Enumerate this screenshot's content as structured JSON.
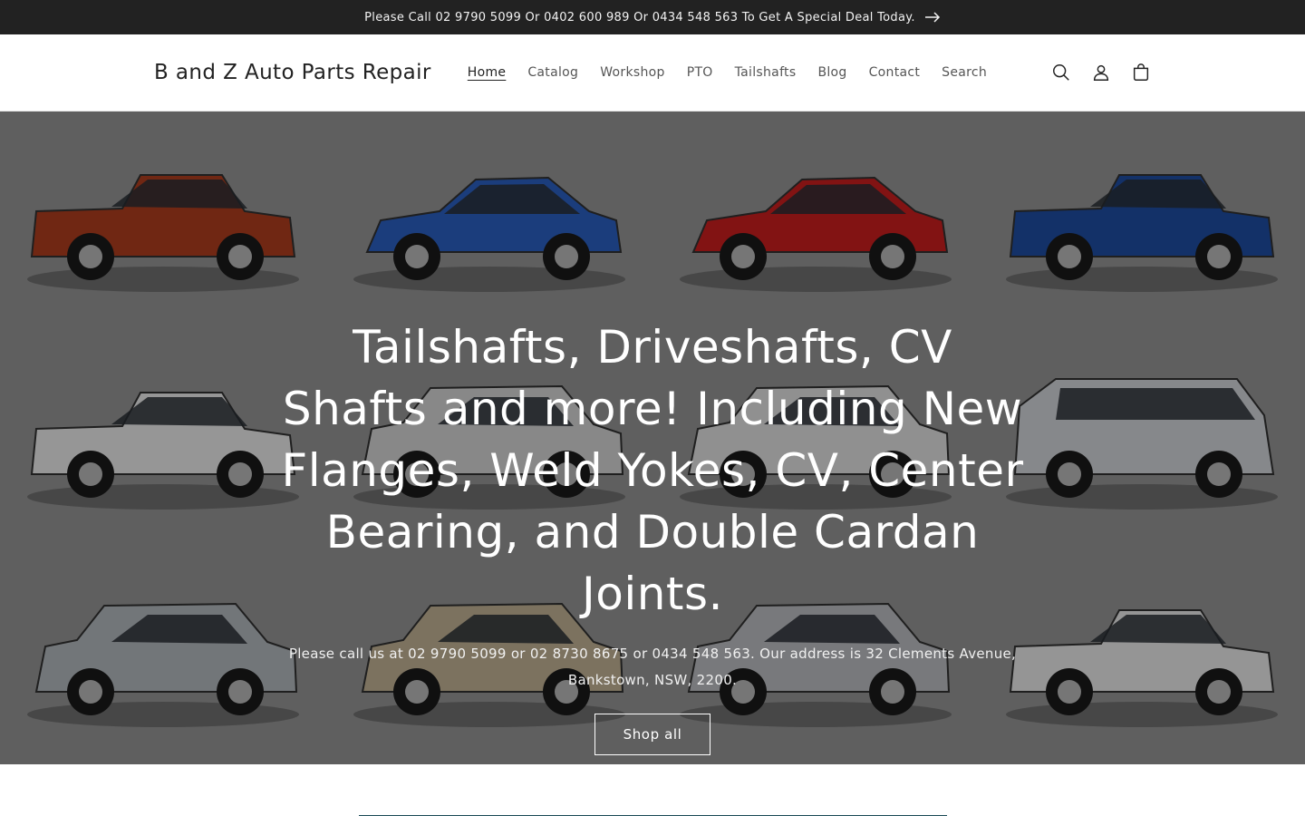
{
  "announcement": {
    "text": "Please Call 02 9790 5099 Or 0402 600 989 Or 0434 548 563 To Get A Special Deal Today.",
    "icon": "arrow-right-icon"
  },
  "header": {
    "brand": "B and Z Auto Parts Repair",
    "nav": [
      {
        "label": "Home",
        "active": true
      },
      {
        "label": "Catalog"
      },
      {
        "label": "Workshop"
      },
      {
        "label": "PTO"
      },
      {
        "label": "Tailshafts"
      },
      {
        "label": "Blog"
      },
      {
        "label": "Contact"
      },
      {
        "label": "Search"
      }
    ],
    "icons": [
      "search-icon",
      "account-icon",
      "cart-icon"
    ]
  },
  "hero": {
    "title": "Tailshafts, Driveshafts, CV Shafts and more! Including New Flanges, Weld Yokes, CV, Center Bearing, and Double Cardan Joints.",
    "subtitle": "Please call us at 02 9790 5099 or 02 8730 8675 or 0434 548 563. Our address is 32 Clements Avenue, Bankstown, NSW, 2200.",
    "button": "Shop all",
    "vehicles": [
      {
        "color": "#b5401f",
        "kind": "ute"
      },
      {
        "color": "#2d63c8",
        "kind": "sedan"
      },
      {
        "color": "#d21f1f",
        "kind": "sedan"
      },
      {
        "color": "#1f4fa8",
        "kind": "ute"
      },
      {
        "color": "#f2f2f2",
        "kind": "ute"
      },
      {
        "color": "#dcdcdc",
        "kind": "suv"
      },
      {
        "color": "#e8e8e8",
        "kind": "suv"
      },
      {
        "color": "#d9dce0",
        "kind": "van"
      },
      {
        "color": "#b9bec4",
        "kind": "suv"
      },
      {
        "color": "#c8b89a",
        "kind": "suv"
      },
      {
        "color": "#c2c4c8",
        "kind": "suv"
      },
      {
        "color": "#f0f0f0",
        "kind": "ute"
      }
    ]
  },
  "colors": {
    "announcement_bg": "#222222",
    "accent_line": "#1a4a55"
  }
}
